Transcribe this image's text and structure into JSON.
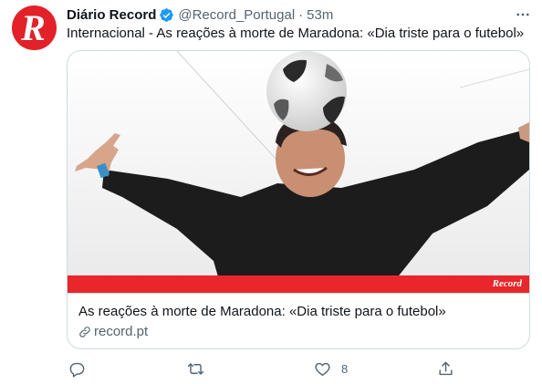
{
  "account": {
    "display_name": "Diário Record",
    "handle": "@Record_Portugal",
    "separator": "·",
    "timestamp": "53m",
    "avatar_letter": "R",
    "avatar_color": "#e32129",
    "verified": true
  },
  "tweet": {
    "text": "Internacional - As reações à morte de Maradona: «Dia triste para o futebol»"
  },
  "card": {
    "title": "As reações à morte de Maradona: «Dia triste para o futebol»",
    "domain": "record.pt",
    "image_watermark": "Record",
    "image_band_color": "#e8262b"
  },
  "actions": {
    "reply_count": "",
    "retweet_count": "",
    "like_count": "8",
    "share_count": ""
  },
  "colors": {
    "text_primary": "#0f1419",
    "text_secondary": "#536471",
    "verified_blue": "#1d9bf0",
    "border": "#cfd9de"
  },
  "icons": [
    "verified-badge-icon",
    "more-options-icon",
    "link-icon",
    "reply-icon",
    "retweet-icon",
    "like-icon",
    "share-icon"
  ]
}
